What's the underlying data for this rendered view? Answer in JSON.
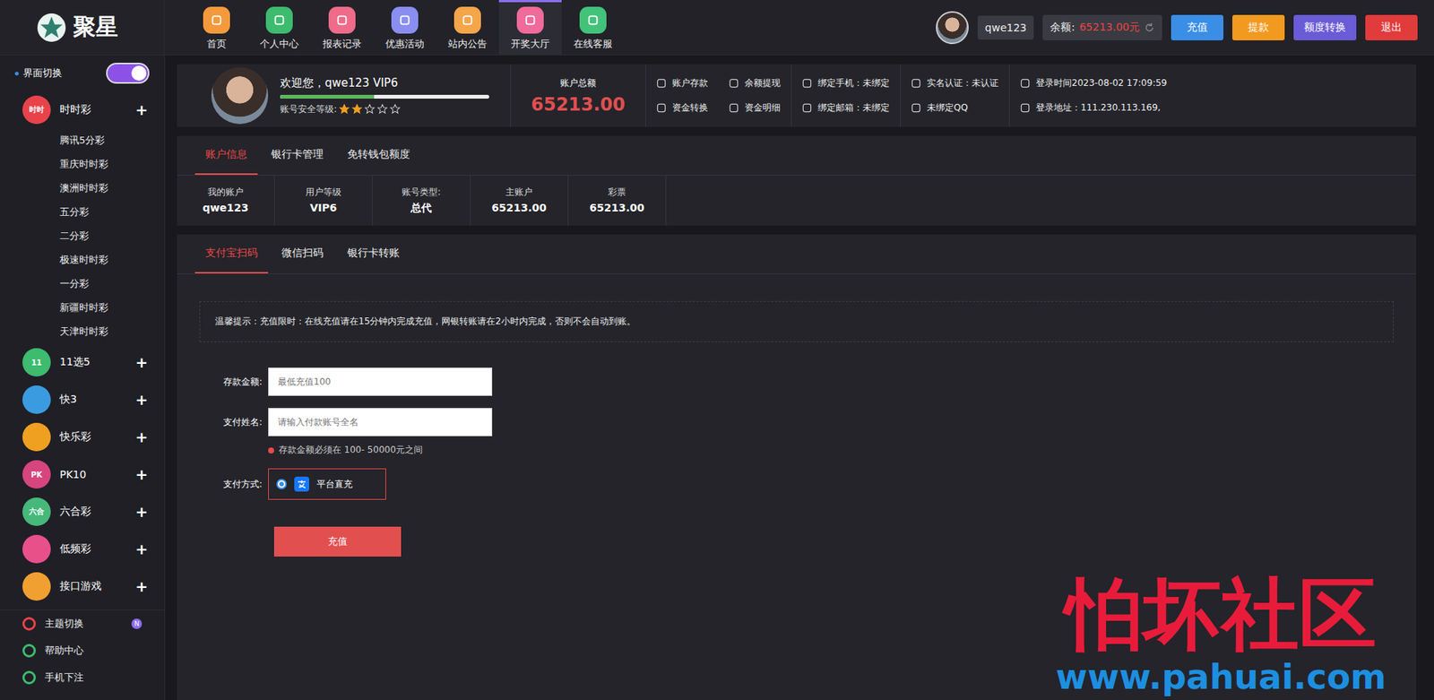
{
  "logo": {
    "text": "聚星"
  },
  "nav": [
    {
      "label": "首页",
      "selected": false,
      "color": "#f59a3c"
    },
    {
      "label": "个人中心",
      "selected": false,
      "color": "#3dbb6e"
    },
    {
      "label": "报表记录",
      "selected": false,
      "color": "#ef6b8a"
    },
    {
      "label": "优惠活动",
      "selected": false,
      "color": "#8a8ef0"
    },
    {
      "label": "站内公告",
      "selected": false,
      "color": "#f5a54a"
    },
    {
      "label": "开奖大厅",
      "selected": true,
      "color": "#f06a9a"
    },
    {
      "label": "在线客服",
      "selected": false,
      "color": "#43c27a"
    }
  ],
  "user": {
    "name": "qwe123",
    "balance_label": "余额:",
    "balance": "65213.00元"
  },
  "header_buttons": [
    {
      "label": "充值",
      "color": "#3a8ee6"
    },
    {
      "label": "提款",
      "color": "#f29a1f"
    },
    {
      "label": "额度转换",
      "color": "#6a5bd6"
    },
    {
      "label": "退出",
      "color": "#e23b3b"
    }
  ],
  "sidebar": {
    "theme_toggle": {
      "label": "界面切换",
      "on": true
    },
    "categories": [
      {
        "name": "时时彩",
        "icon_text": "时时",
        "color": "#e8434a",
        "toggle": "+",
        "expanded": true,
        "items": [
          "腾讯5分彩",
          "重庆时时彩",
          "澳洲时时彩",
          "五分彩",
          "二分彩",
          "极速时时彩",
          "一分彩",
          "新疆时时彩",
          "天津时时彩"
        ]
      },
      {
        "name": "11选5",
        "icon_text": "11",
        "color": "#3dbb6e",
        "toggle": "+",
        "expanded": false,
        "items": []
      },
      {
        "name": "快3",
        "icon_text": "",
        "color": "#3b9be0",
        "toggle": "+",
        "expanded": false,
        "items": []
      },
      {
        "name": "快乐彩",
        "icon_text": "",
        "color": "#f0a020",
        "toggle": "+",
        "expanded": false,
        "items": []
      },
      {
        "name": "PK10",
        "icon_text": "PK",
        "color": "#d6457e",
        "toggle": "+",
        "expanded": false,
        "items": []
      },
      {
        "name": "六合彩",
        "icon_text": "六合",
        "color": "#46b87a",
        "toggle": "+",
        "expanded": false,
        "items": []
      },
      {
        "name": "低频彩",
        "icon_text": "",
        "color": "#e8508a",
        "toggle": "+",
        "expanded": false,
        "items": []
      },
      {
        "name": "接口游戏",
        "icon_text": "",
        "color": "#f0a030",
        "toggle": "+",
        "expanded": false,
        "items": []
      }
    ],
    "footer": [
      {
        "label": "主题切换",
        "badge": "N",
        "color": "#e8434a"
      },
      {
        "label": "帮助中心",
        "badge": "",
        "color": "#3dbb6e"
      },
      {
        "label": "手机下注",
        "badge": "",
        "color": "#3dbb6e"
      }
    ]
  },
  "profile": {
    "greeting": "欢迎您，qwe123 VIP6",
    "level": 0.45,
    "security_label": "账号安全等级:",
    "stars": 2,
    "stars_total": 5,
    "total_label": "账户总额",
    "total": "65213.00",
    "links": [
      [
        "账户存款",
        "资金转换"
      ],
      [
        "余额提现",
        "资金明细"
      ],
      [
        "绑定手机：未绑定",
        "绑定邮箱：未绑定"
      ],
      [
        "实名认证：未认证",
        "未绑定QQ"
      ],
      [
        "登录时间2023-08-02 17:09:59",
        "登录地址：111.230.113.169,"
      ]
    ]
  },
  "account_tabs": [
    {
      "label": "账户信息",
      "selected": true
    },
    {
      "label": "银行卡管理",
      "selected": false
    },
    {
      "label": "免转钱包额度",
      "selected": false
    }
  ],
  "account_info": [
    {
      "label": "我的账户",
      "value": "qwe123"
    },
    {
      "label": "用户等级",
      "value": "VIP6"
    },
    {
      "label": "账号类型:",
      "value": "总代"
    },
    {
      "label": "主账户",
      "value": "65213.00"
    },
    {
      "label": "彩票",
      "value": "65213.00"
    }
  ],
  "deposit": {
    "tabs": [
      {
        "label": "支付宝扫码",
        "selected": true
      },
      {
        "label": "微信扫码",
        "selected": false
      },
      {
        "label": "银行卡转账",
        "selected": false
      }
    ],
    "notice": "温馨提示：充值限时：在线充值请在15分钟内完成充值，网银转账请在2小时内完成，否则不会自动到账。",
    "amount_label": "存款金额:",
    "amount_placeholder": "最低充值100",
    "name_label": "支付姓名:",
    "name_placeholder": "请输入付款账号全名",
    "hint": "存款金额必须在 100- 50000元之间",
    "method_label": "支付方式:",
    "methods": [
      {
        "label": "平台直充",
        "selected": true
      }
    ],
    "submit": "充值"
  },
  "watermark": {
    "title": "怕坏社区",
    "url": "www.pahuai.com"
  }
}
